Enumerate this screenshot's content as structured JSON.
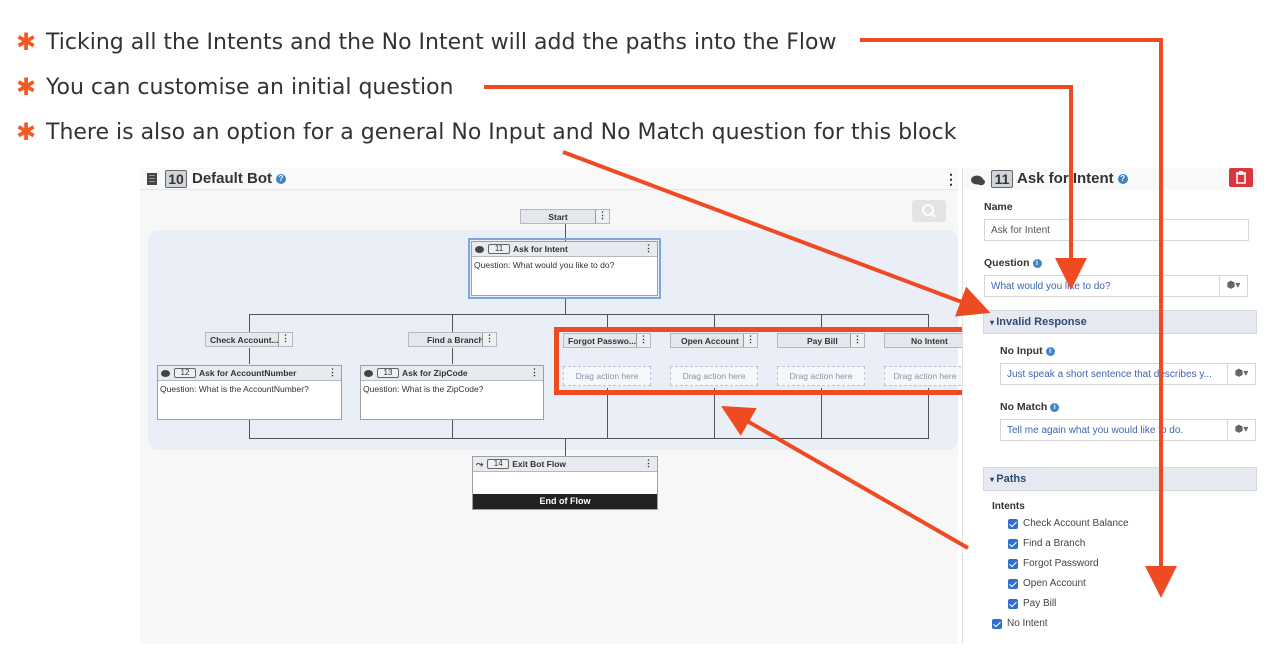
{
  "bullets": [
    "Ticking all the Intents and the No Intent will add the paths into the Flow",
    "You can customise an initial question",
    "There is also an option for a general No Input and No Match question for this block"
  ],
  "bullet_marker": "✱",
  "canvas": {
    "number": "10",
    "title": "Default Bot",
    "help": "?",
    "kebab": "⋮",
    "start_label": "Start",
    "ask_intent": {
      "number": "11",
      "title": "Ask for Intent",
      "question": "Question: What would you like to do?"
    },
    "branches": [
      {
        "pill": "Check Account...",
        "number": "12",
        "title": "Ask for AccountNumber",
        "question": "Question: What is the AccountNumber?"
      },
      {
        "pill": "Find a Branch",
        "number": "13",
        "title": "Ask for ZipCode",
        "question": "Question: What is the ZipCode?"
      }
    ],
    "empty_branches": [
      "Forgot Passwo...",
      "Open Account",
      "Pay Bill",
      "No Intent"
    ],
    "drag_label": "Drag action here",
    "exit": {
      "number": "14",
      "title": "Exit Bot Flow",
      "footer": "End of Flow"
    }
  },
  "panel": {
    "number": "11",
    "title": "Ask for Intent",
    "help": "?",
    "name_label": "Name",
    "name_value": "Ask for Intent",
    "question_label": "Question",
    "question_value": "What would you like to do?",
    "invalid_section": "Invalid Response",
    "no_input_label": "No Input",
    "no_input_value": "Just speak a short sentence that describes y...",
    "no_match_label": "No Match",
    "no_match_value": "Tell me again what you would like to do.",
    "paths_section": "Paths",
    "intents_label": "Intents",
    "intents": [
      "Check Account Balance",
      "Find a Branch",
      "Forgot Password",
      "Open Account",
      "Pay Bill"
    ],
    "no_intent": "No Intent",
    "cube_icon": "⬢▾",
    "info": "i"
  },
  "colors": {
    "accent": "#f15a24",
    "highlight": "#ee4b22",
    "link": "#3f64b4",
    "checkbox": "#2f6fd1",
    "danger": "#d9363e"
  }
}
